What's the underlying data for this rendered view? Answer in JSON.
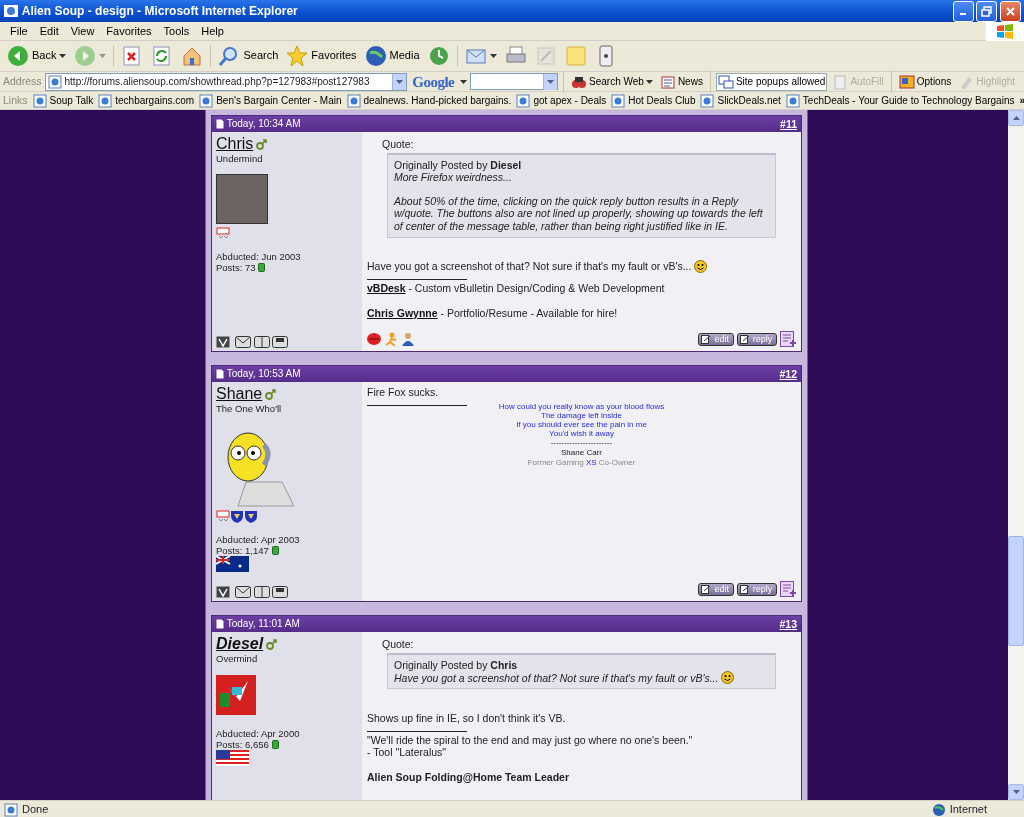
{
  "window": {
    "title": "Alien Soup - design - Microsoft Internet Explorer"
  },
  "menu": [
    "File",
    "Edit",
    "View",
    "Favorites",
    "Tools",
    "Help"
  ],
  "toolbar": [
    {
      "kind": "back",
      "label": "Back",
      "dropdown": true,
      "disabled": false
    },
    {
      "kind": "forward",
      "dropdown": true,
      "disabled": true
    },
    {
      "kind": "stop",
      "dropdown": false,
      "disabled": false
    },
    {
      "kind": "refresh",
      "dropdown": false,
      "disabled": false
    },
    {
      "kind": "home",
      "dropdown": false,
      "disabled": false
    },
    {
      "kind": "search",
      "label": "Search",
      "dropdown": false,
      "disabled": false
    },
    {
      "kind": "favorites",
      "label": "Favorites",
      "dropdown": false,
      "disabled": false
    },
    {
      "kind": "media",
      "label": "Media",
      "dropdown": false,
      "disabled": false
    },
    {
      "kind": "history",
      "dropdown": false,
      "disabled": false
    },
    {
      "kind": "mail",
      "dropdown": true,
      "disabled": false
    },
    {
      "kind": "print",
      "dropdown": false,
      "disabled": false
    },
    {
      "kind": "edit",
      "dropdown": false,
      "disabled": true
    },
    {
      "kind": "note",
      "dropdown": false,
      "disabled": false
    },
    {
      "kind": "messenger",
      "dropdown": false,
      "disabled": false
    }
  ],
  "address": {
    "label": "Address",
    "url": "http://forums.aliensoup.com/showthread.php?p=127983#post127983"
  },
  "google_bar": {
    "logo": "Google",
    "buttons": [
      {
        "kind": "search-web",
        "label": "Search Web",
        "dropdown": true,
        "disabled": false
      },
      {
        "kind": "news",
        "label": "News",
        "dropdown": false,
        "disabled": false
      },
      {
        "kind": "popups",
        "label": "Site popups allowed",
        "dropdown": false,
        "disabled": false
      },
      {
        "kind": "autofill",
        "label": "AutoFill",
        "dropdown": false,
        "disabled": true
      },
      {
        "kind": "options",
        "label": "Options",
        "dropdown": false,
        "disabled": false
      },
      {
        "kind": "highlight",
        "label": "Highlight",
        "dropdown": false,
        "disabled": true
      }
    ]
  },
  "links": {
    "label": "Links",
    "items": [
      "Soup Talk",
      "techbargains.com",
      "Ben's Bargain Center - Main",
      "dealnews. Hand-picked bargains.",
      "got apex - Deals",
      "Hot Deals Club",
      "SlickDeals.net",
      "TechDeals - Your Guide to Technology Bargains"
    ],
    "more": "»"
  },
  "posts": [
    {
      "date": "Today, 10:34 AM",
      "number": "#11",
      "user": {
        "name": "Chris",
        "bold_italic": false,
        "title": "Undermind",
        "avatar": {
          "kind": "photo"
        },
        "badges": [
          {
            "kind": "tag"
          }
        ],
        "joined": "Abducted: Jun 2003",
        "posts": "Posts: 73"
      },
      "quote": {
        "label": "Quote:",
        "by": "Originally Posted by **Diesel**",
        "paragraphs": [
          "More Firefox weirdness...",
          "About 50% of the time, clicking on the quick reply button results in a Reply w/quote. The buttons also are not lined up properly, showing up towards the left of center of the message table, rather than being right justified like in IE."
        ],
        "smiley": false
      },
      "message": "Have you got a screenshot of that? Not sure if that's my fault or vB's...",
      "smiley": true,
      "signature": [
        {
          "kind": "link",
          "link": "vBDesk",
          "text": " - Custom vBulletin Design/Coding & Web Development"
        },
        {
          "kind": "link",
          "link": "Chris Gwynne",
          "text": " - Portfolio/Resume - Available for hire!"
        }
      ],
      "extra_icons": [
        {
          "kind": "lips"
        },
        {
          "kind": "running-figure"
        },
        {
          "kind": "person"
        }
      ],
      "buttons": [
        "edit",
        "reply"
      ]
    },
    {
      "date": "Today, 10:53 AM",
      "number": "#12",
      "user": {
        "name": "Shane",
        "bold_italic": false,
        "title": "The One Who'll",
        "avatar": {
          "kind": "cartoon"
        },
        "badges": [
          {
            "kind": "tag"
          },
          {
            "kind": "shield"
          },
          {
            "kind": "shield"
          }
        ],
        "joined": "Abducted: Apr 2003",
        "posts": "Posts: 1,147",
        "flag": {
          "kind": "australia"
        }
      },
      "message": "Fire Fox sucks.",
      "smiley": false,
      "signature": [
        {
          "kind": "lyric",
          "text": "How could you really know as your blood flows"
        },
        {
          "kind": "lyric",
          "text": "The damage left inside"
        },
        {
          "kind": "lyric",
          "text": "If you should ever see the pain in me"
        },
        {
          "kind": "lyric",
          "text": "You'd wish it away"
        },
        {
          "kind": "dashes",
          "text": "-----------------------"
        },
        {
          "kind": "name",
          "text": "Shane Carr"
        },
        {
          "kind": "credit",
          "parts": [
            "Former Gaming ",
            "XS",
            " Co-Owner"
          ]
        }
      ],
      "buttons": [
        "edit",
        "reply"
      ]
    },
    {
      "date": "Today, 11:01 AM",
      "number": "#13",
      "user": {
        "name": "Diesel",
        "bold_italic": true,
        "title": "Overmind",
        "avatar": {
          "kind": "pixel-art"
        },
        "joined": "Abducted: Apr 2000",
        "posts": "Posts: 6,656",
        "flag": {
          "kind": "usa"
        }
      },
      "quote": {
        "label": "Quote:",
        "by": "Originally Posted by **Chris**",
        "paragraphs": [
          "Have you got a screenshot of that? Not sure if that's my fault or vB's..."
        ],
        "smiley": true
      },
      "message": "Shows up fine in IE, so I don't think it's VB.",
      "smiley": false,
      "signature": [
        {
          "kind": "plain",
          "text": "\"We'll ride the spiral to the end and may just go where no one's been.\""
        },
        {
          "kind": "plain",
          "text": "- Tool \"Lateralus\""
        },
        {
          "kind": "bold",
          "text": "Alien Soup Folding@Home Team Leader"
        }
      ]
    }
  ],
  "status": {
    "text": "Done",
    "zone": "Internet"
  }
}
